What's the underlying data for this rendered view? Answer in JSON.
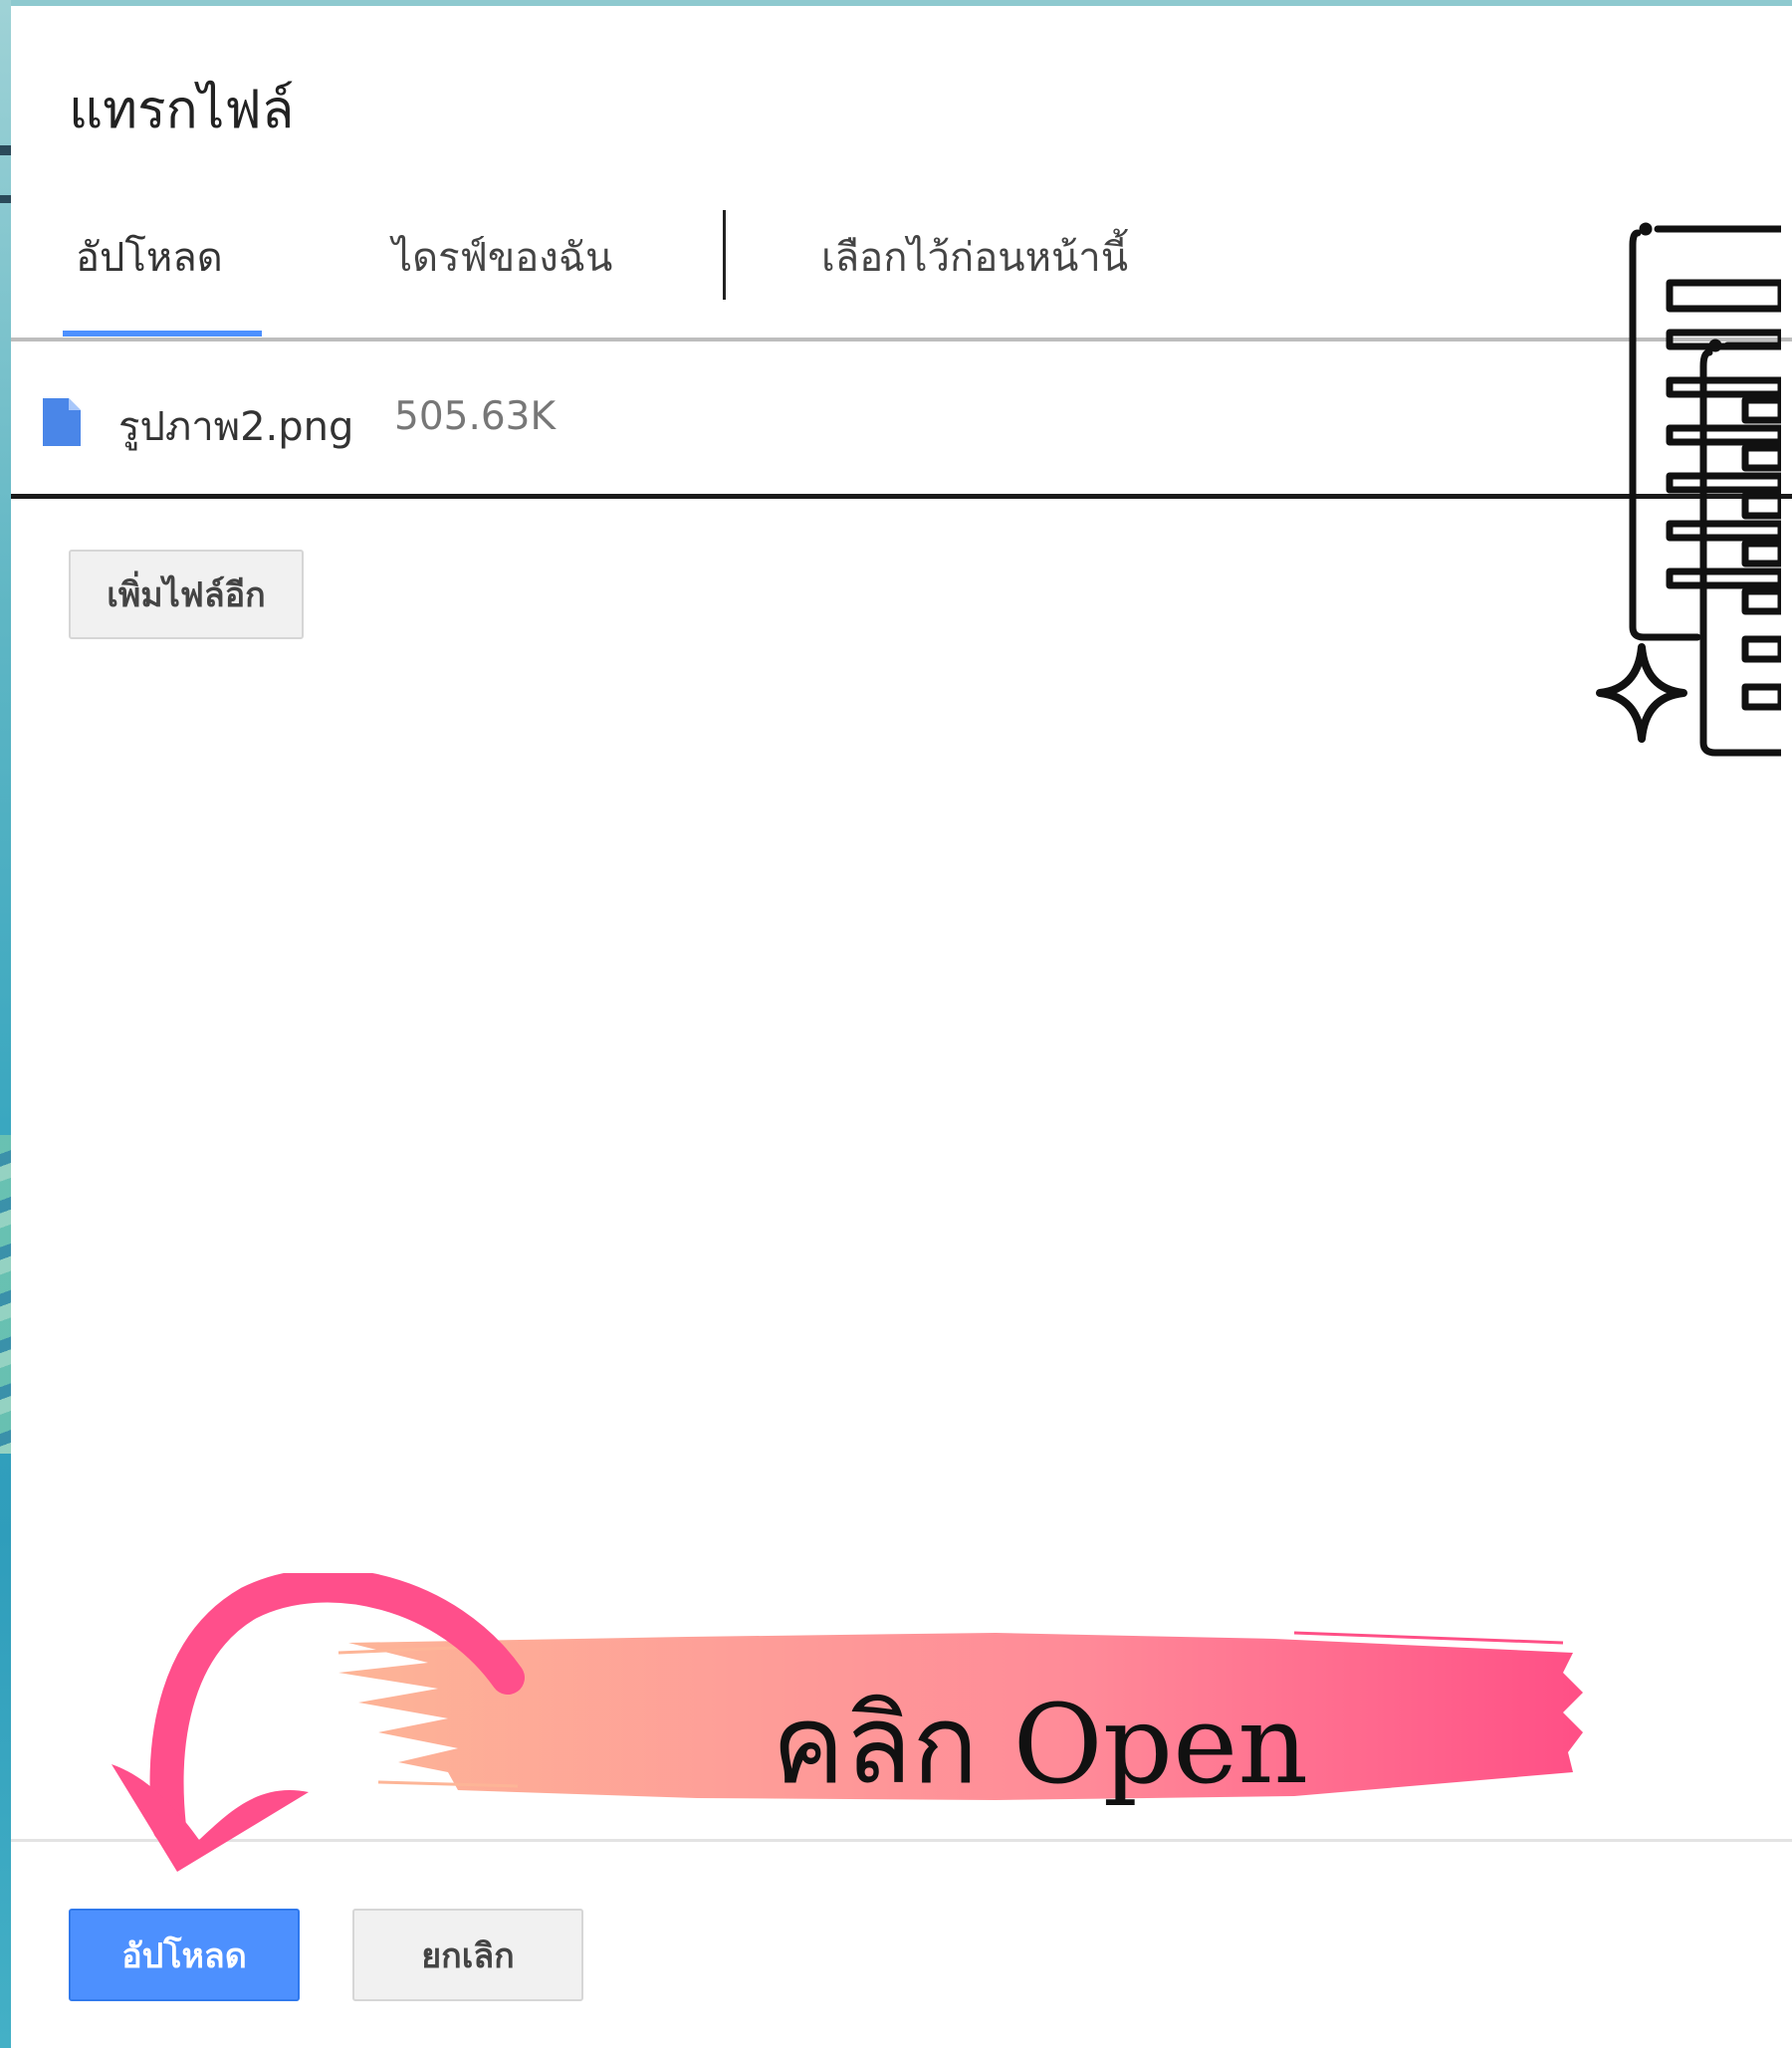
{
  "dialog": {
    "title": "แทรกไฟล์",
    "tabs": [
      {
        "label": "อัปโหลด",
        "active": true
      },
      {
        "label": "ไดรฟ์ของฉัน",
        "active": false
      },
      {
        "label": "เลือกไว้ก่อนหน้านี้",
        "active": false
      }
    ],
    "file": {
      "name": "รูปภาพ2.png",
      "size": "505.63K",
      "icon": "file-icon"
    },
    "add_more_label": "เพิ่มไฟล์อีก",
    "footer": {
      "upload_label": "อัปโหลด",
      "cancel_label": "ยกเลิก"
    }
  },
  "annotation": {
    "text": "คลิก Open",
    "arrow_color": "#ff4f8b",
    "brush_from": "#fdb597",
    "brush_to": "#ff4f86"
  },
  "colors": {
    "accent": "#4d90fe",
    "page_bg": "#3aa7c0"
  }
}
